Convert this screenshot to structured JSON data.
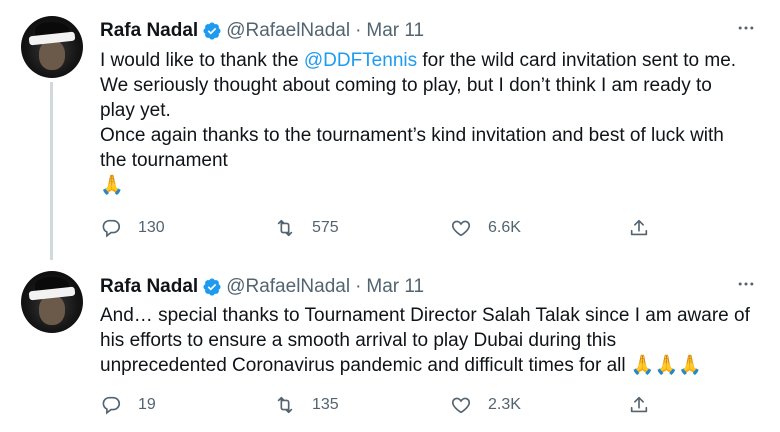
{
  "tweets": [
    {
      "author_name": "Rafa Nadal",
      "handle": "@RafaelNadal",
      "separator": "·",
      "date": "Mar 11",
      "body_lines": {
        "l1_pre": "I would like to thank the ",
        "l1_mention": "@DDFTennis",
        "l1_post": " for the wild card invitation sent to me.",
        "l2": "We seriously thought about coming to play, but I don’t think I am ready to",
        "l3": "play yet.",
        "l4": "Once again thanks to the tournament’s kind invitation and best of luck with",
        "l5": "the tournament",
        "l6": "🙏"
      },
      "replies": "130",
      "retweets": "575",
      "likes": "6.6K"
    },
    {
      "author_name": "Rafa Nadal",
      "handle": "@RafaelNadal",
      "separator": "·",
      "date": "Mar 11",
      "body_lines": {
        "l1": "And… special thanks to Tournament Director Salah Talak since I am aware of",
        "l2": "his efforts to ensure a smooth arrival to play Dubai during this",
        "l3": "unprecedented Coronavirus pandemic and difficult times for all ",
        "l3_emoji": "🙏🙏🙏"
      },
      "replies": "19",
      "retweets": "135",
      "likes": "2.3K"
    }
  ],
  "icons": {
    "more": "more-horizontal-icon",
    "verified": "verified-badge-icon",
    "reply": "reply-icon",
    "retweet": "retweet-icon",
    "like": "heart-icon",
    "share": "share-icon"
  },
  "colors": {
    "text": "#0f1419",
    "secondary": "#536471",
    "accent": "#1d9bf0",
    "thread_line": "#cfd9de"
  }
}
